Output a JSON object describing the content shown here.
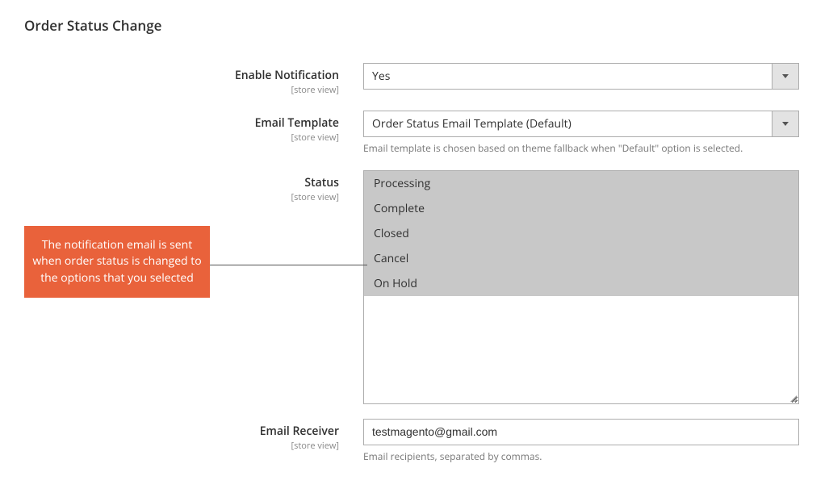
{
  "section": {
    "title": "Order Status Change"
  },
  "fields": {
    "enable_notification": {
      "label": "Enable Notification",
      "scope": "[store view]",
      "value": "Yes"
    },
    "email_template": {
      "label": "Email Template",
      "scope": "[store view]",
      "value": "Order Status Email Template (Default)",
      "note": "Email template is chosen based on theme fallback when \"Default\" option is selected."
    },
    "status": {
      "label": "Status",
      "scope": "[store view]",
      "options": [
        {
          "label": "Processing",
          "selected": true
        },
        {
          "label": "Complete",
          "selected": true
        },
        {
          "label": "Closed",
          "selected": true
        },
        {
          "label": "Cancel",
          "selected": true
        },
        {
          "label": "On Hold",
          "selected": true
        }
      ]
    },
    "email_receiver": {
      "label": "Email Receiver",
      "scope": "[store view]",
      "value": "testmagento@gmail.com",
      "note": "Email recipients, separated by commas."
    }
  },
  "callout": {
    "text": "The notification email is sent when order status is changed to the options that you selected"
  }
}
